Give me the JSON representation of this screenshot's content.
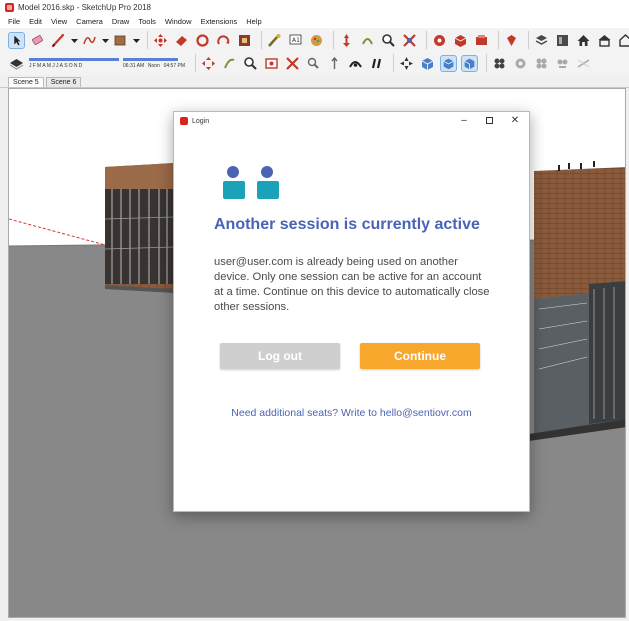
{
  "window": {
    "title": "Model 2016.skp - SketchUp Pro 2018"
  },
  "menu": [
    "File",
    "Edit",
    "View",
    "Camera",
    "Draw",
    "Tools",
    "Window",
    "Extensions",
    "Help"
  ],
  "shadows": {
    "months": [
      "J",
      "F",
      "M",
      "A",
      "M",
      "J",
      "J",
      "A",
      "S",
      "O",
      "N",
      "D"
    ],
    "time_start": "06:31 AM",
    "time_mid": "Noon",
    "time_end": "04:57 PM"
  },
  "scene_tabs": [
    "Scene 5",
    "Scene 6"
  ],
  "dialog": {
    "title": "Login",
    "heading": "Another session is currently active",
    "body": "user@user.com is already being used on another device. Only one session can be active for an account at a time. Continue on this device to automatically close other sessions.",
    "logout_label": "Log out",
    "continue_label": "Continue",
    "seats_text": "Need additional seats? Write to hello@sentiovr.com",
    "minimize_glyph": "–",
    "close_glyph": "✕"
  },
  "colors": {
    "accent": "#f7a72b",
    "heading": "#4a63b5",
    "people_body": "#1aa3b8",
    "people_head": "#4a63b5",
    "logout_bg": "#cfcfcf"
  },
  "icons": {
    "toolbar1": [
      "select-arrow-icon",
      "eraser-icon",
      "pencil-line-icon",
      "dropdown-caret-icon",
      "freehand-icon",
      "dropdown-caret-icon",
      "paint-bucket-icon",
      "dropdown-caret-icon",
      "move-icon",
      "push-pull-icon",
      "orbit-icon",
      "rotate-icon",
      "offset-icon",
      "tape-measure-icon",
      "text-icon",
      "paint-icon",
      "pan-icon",
      "zoom-icon",
      "zoom-extents-icon",
      "warehouse-icon",
      "extension-icon",
      "component-icon",
      "ruby-icon",
      "layers-icon",
      "outliner-icon",
      "house-icon",
      "styles-icon",
      "home-icon"
    ],
    "toolbar2": [
      "shadow-icon",
      "section-plane-icon",
      "walk-icon",
      "look-around-icon",
      "position-camera-icon",
      "dimension-icon",
      "protractor-icon",
      "axes-icon",
      "3d-text-icon",
      "iso-view-icon",
      "top-view-icon",
      "front-view-icon",
      "right-view-icon",
      "back-view-icon",
      "left-view-icon",
      "xray-icon",
      "wireframe-icon",
      "hidden-line-icon",
      "shaded-icon",
      "textured-icon",
      "monochrome-icon"
    ],
    "dialog_icon": "sketchup-icon",
    "people_icon": "two-users-icon"
  }
}
